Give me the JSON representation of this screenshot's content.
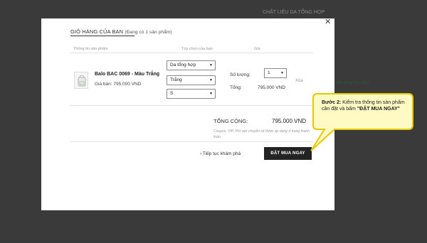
{
  "background": {
    "top_text": "CHẤT LIỆU DA TỔNG HỢP",
    "side_text": "cho tổng hóa đơn"
  },
  "modal": {
    "title": "GIỎ HÀNG CỦA BẠN",
    "count_prefix": "(Đang có",
    "count_value": "1",
    "count_suffix": "sản phẩm)",
    "columns": {
      "product": "Thông tin sản phẩm",
      "options": "Tùy chọn của bạn",
      "price": "Giá"
    },
    "item": {
      "name": "Balo BAC 0069 - Màu Trắng",
      "price_label": "Giá bán: 795.000 VND",
      "material_option": "Da tổng hợp",
      "color_option": "Trắng",
      "size_option": "S",
      "qty_label": "Số lượng:",
      "qty_value": "1",
      "total_label": "Tổng:",
      "total_value": "795.000 VND",
      "delete_label": "Xóa"
    },
    "summary": {
      "grand_label": "TỔNG CỘNG:",
      "grand_value": "795.000 VND",
      "note": "Coupon, VIP, Phí vận chuyển sẽ được áp dụng ở trang thanh toán."
    },
    "continue_label": "Tiếp tục khám phá",
    "buy_label": "ĐẶT MUA NGAY"
  },
  "tooltip": {
    "step": "Bước 2:",
    "text_a": "Kiểm tra thông tin sản phẩm cần đặt và bấm",
    "text_b": "\"ĐẶT MUA NGAY\"",
    "fill": "#fff9c4",
    "stroke": "#e6c800"
  },
  "colors": {
    "overlay": "#3a3a3a",
    "button": "#232323"
  }
}
